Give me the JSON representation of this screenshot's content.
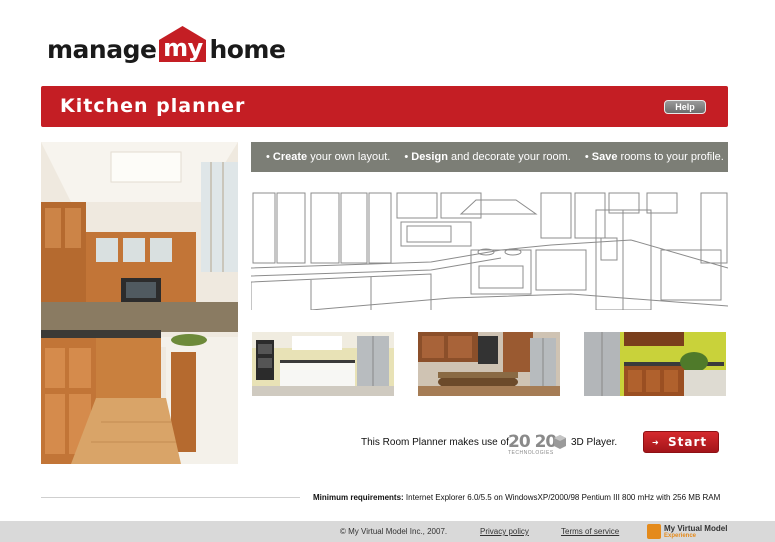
{
  "logo": {
    "manage": "manage",
    "my": "my",
    "home": "home"
  },
  "header": {
    "title": "Kitchen planner",
    "help_label": "Help"
  },
  "features": [
    {
      "bold": "Create",
      "rest": " your own layout."
    },
    {
      "bold": "Design",
      "rest": " and decorate your room."
    },
    {
      "bold": "Save",
      "rest": " rooms to your profile."
    }
  ],
  "player": {
    "text": "This Room Planner makes use of",
    "logo_big": "20 20",
    "logo_small": "TECHNOLOGIES",
    "suffix": "3D Player.",
    "start_label": "Start",
    "start_arrow": "➜"
  },
  "requirements": {
    "label": "Minimum requirements:",
    "text": " Internet Explorer 6.0/5.5 on WindowsXP/2000/98 Pentium III 800 mHz with 256 MB RAM"
  },
  "footer": {
    "copyright": "© My Virtual Model Inc., 2007.",
    "privacy": "Privacy policy",
    "terms": "Terms of service",
    "brand_line1": "My Virtual Model",
    "brand_line2": "Experience"
  },
  "colors": {
    "brand_red": "#c41e24",
    "strip_gray": "#7c7e76",
    "footer_gray": "#d9d9d9"
  }
}
